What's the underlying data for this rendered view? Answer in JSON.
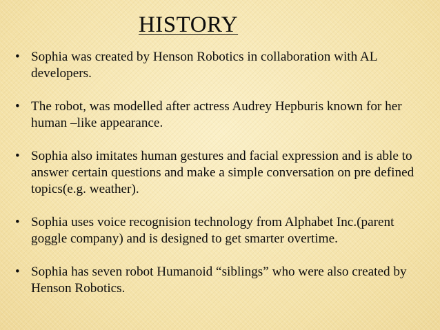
{
  "slide": {
    "title": "HISTORY",
    "bullet_symbol": "•",
    "bullets": [
      "Sophia was created by Henson Robotics in collaboration with AL developers.",
      "The robot, was modelled after actress Audrey Hepburis known for her human –like appearance.",
      "Sophia also imitates human gestures and facial expression and is able to answer certain questions and make a simple conversation on pre defined topics(e.g. weather).",
      "Sophia uses voice recognision technology from Alphabet Inc.(parent goggle company) and is designed to get smarter overtime.",
      "Sophia has seven robot Humanoid “siblings” who were also created by Henson Robotics."
    ]
  }
}
